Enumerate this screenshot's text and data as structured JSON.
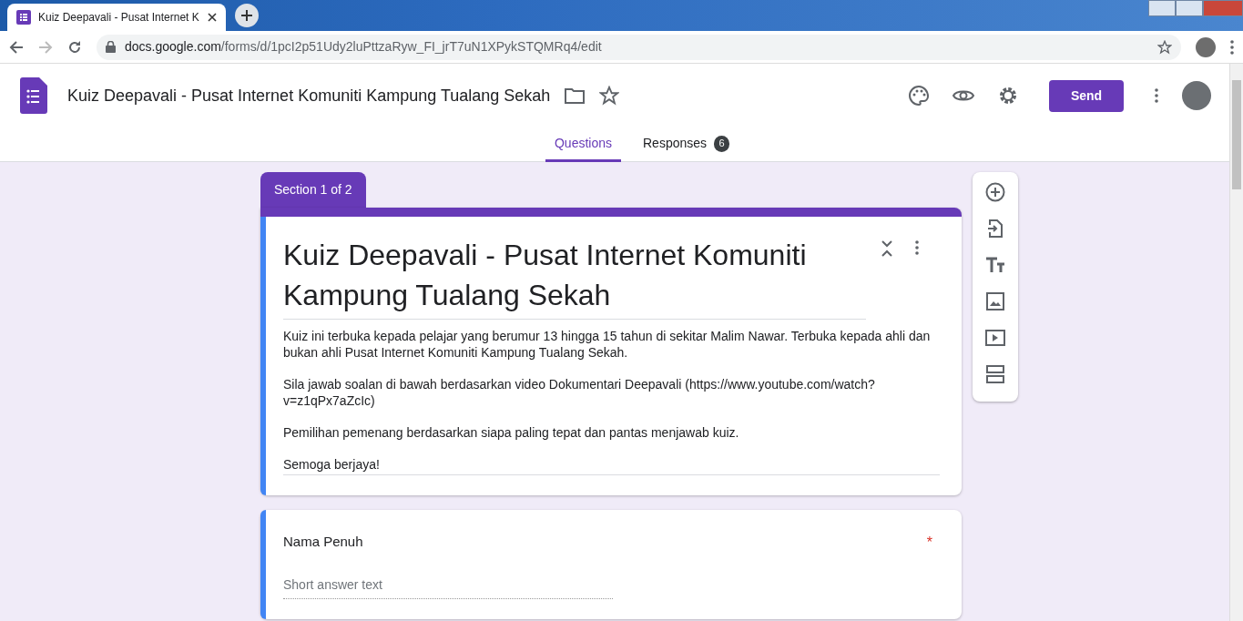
{
  "browser": {
    "tab_title": "Kuiz Deepavali - Pusat Internet K",
    "url_host": "docs.google.com",
    "url_path": "/forms/d/1pcI2p51Udy2luPttzaRyw_FI_jrT7uN1XPykSTQMRq4/edit"
  },
  "header": {
    "title": "Kuiz Deepavali - Pusat Internet Komuniti Kampung Tualang Sekah",
    "send_label": "Send"
  },
  "tabs": [
    {
      "label": "Questions",
      "selected": true
    },
    {
      "label": "Responses",
      "selected": false,
      "count": "6"
    }
  ],
  "section": {
    "label": "Section 1 of 2",
    "title": "Kuiz Deepavali - Pusat Internet Komuniti Kampung Tualang Sekah",
    "description": [
      "Kuiz ini terbuka kepada pelajar yang berumur 13 hingga 15 tahun di sekitar Malim Nawar. Terbuka kepada ahli dan bukan ahli Pusat Internet Komuniti Kampung Tualang Sekah.",
      "Sila jawab soalan di bawah berdasarkan video Dokumentari Deepavali (https://www.youtube.com/watch?v=z1qPx7aZcIc)",
      "Pemilihan pemenang berdasarkan siapa paling tepat dan pantas menjawab kuiz.",
      "Semoga berjaya!"
    ]
  },
  "questions": [
    {
      "title": "Nama Penuh",
      "required": true,
      "required_mark": "*",
      "placeholder": "Short answer text"
    }
  ]
}
